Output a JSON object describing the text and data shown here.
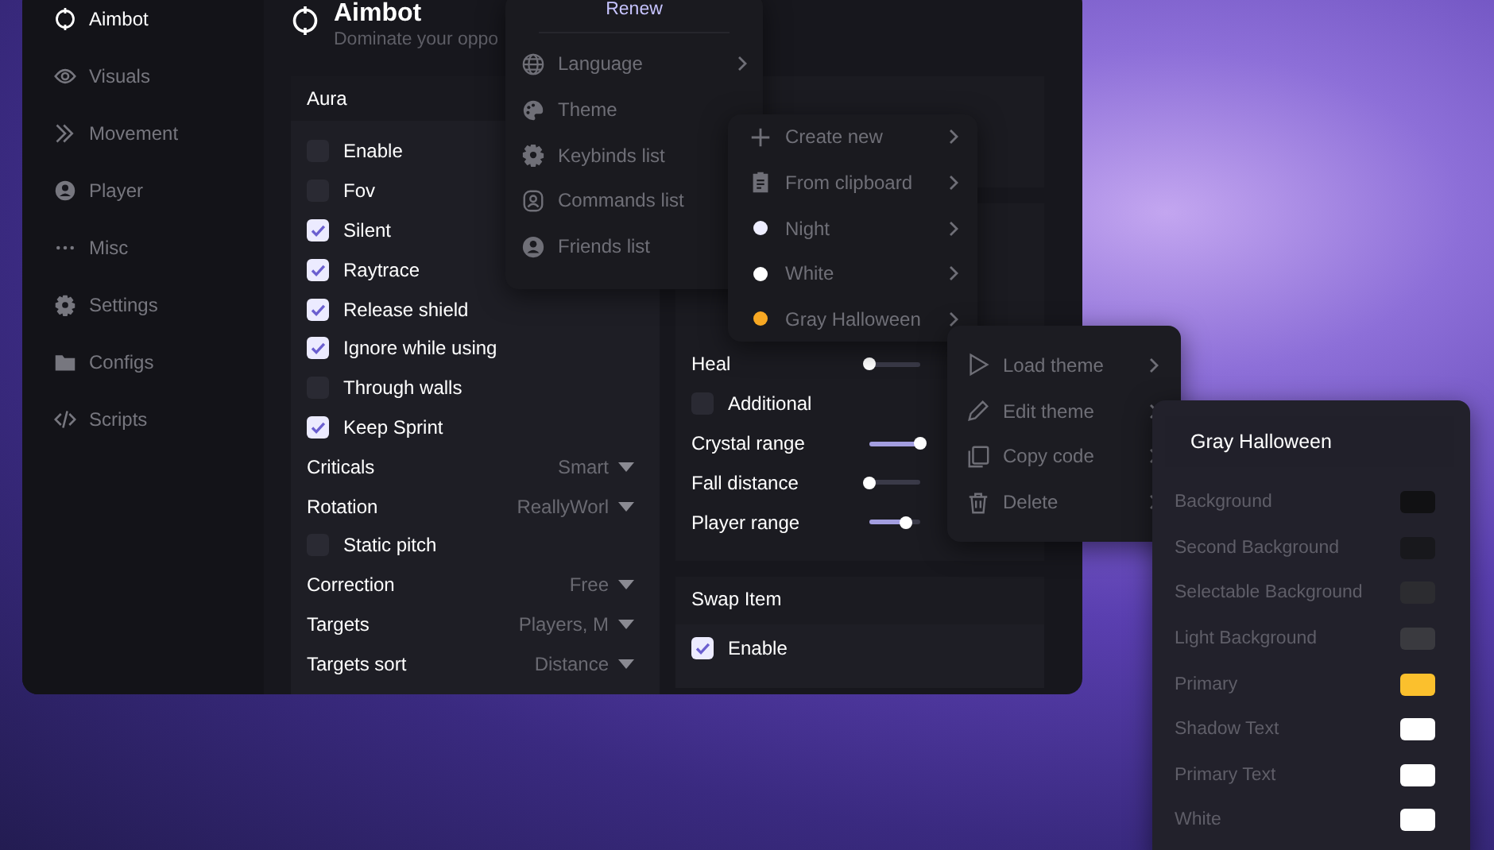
{
  "sidebar": {
    "items": [
      {
        "label": "Aimbot",
        "selected": true
      },
      {
        "label": "Visuals",
        "selected": false
      },
      {
        "label": "Movement",
        "selected": false
      },
      {
        "label": "Player",
        "selected": false
      },
      {
        "label": "Misc",
        "selected": false
      },
      {
        "label": "Settings",
        "selected": false
      },
      {
        "label": "Configs",
        "selected": false
      },
      {
        "label": "Scripts",
        "selected": false
      }
    ]
  },
  "header": {
    "title": "Aimbot",
    "subtitle": "Dominate your oppo"
  },
  "aura": {
    "title": "Aura",
    "rows": [
      {
        "kind": "checkbox",
        "label": "Enable",
        "checked": false
      },
      {
        "kind": "checkbox",
        "label": "Fov",
        "checked": false
      },
      {
        "kind": "checkbox",
        "label": "Silent",
        "checked": true
      },
      {
        "kind": "checkbox",
        "label": "Raytrace",
        "checked": true
      },
      {
        "kind": "checkbox",
        "label": "Release shield",
        "checked": true
      },
      {
        "kind": "checkbox",
        "label": "Ignore while using",
        "checked": true
      },
      {
        "kind": "checkbox",
        "label": "Through walls",
        "checked": false
      },
      {
        "kind": "checkbox",
        "label": "Keep Sprint",
        "checked": true
      },
      {
        "kind": "select",
        "label": "Criticals",
        "value": "Smart"
      },
      {
        "kind": "select",
        "label": "Rotation",
        "value": "ReallyWorl"
      },
      {
        "kind": "checkbox",
        "label": "Static pitch",
        "checked": false
      },
      {
        "kind": "select",
        "label": "Correction",
        "value": "Free"
      },
      {
        "kind": "select",
        "label": "Targets",
        "value": "Players, M"
      },
      {
        "kind": "select",
        "label": "Targets sort",
        "value": "Distance"
      }
    ]
  },
  "movement_panel": {
    "rows": [
      {
        "kind": "slider",
        "label": "Heal",
        "level": 0
      },
      {
        "kind": "checkbox",
        "label": "Additional",
        "checked": false
      },
      {
        "kind": "slider",
        "label": "Crystal range",
        "level": 1
      },
      {
        "kind": "slider",
        "label": "Fall distance",
        "level": 0
      },
      {
        "kind": "slider",
        "label": "Player range",
        "level": 0.72
      }
    ]
  },
  "swap_item": {
    "title": "Swap Item",
    "rows": [
      {
        "label": "Enable",
        "checked": true
      }
    ]
  },
  "menu": {
    "header": "Renew",
    "items": [
      {
        "label": "Language",
        "submenu": true
      },
      {
        "label": "Theme"
      },
      {
        "label": "Keybinds list"
      },
      {
        "label": "Commands list"
      },
      {
        "label": "Friends list"
      }
    ]
  },
  "theme_menu": {
    "items": [
      {
        "kind": "action",
        "label": "Create new"
      },
      {
        "kind": "action",
        "label": "From clipboard"
      },
      {
        "kind": "theme",
        "label": "Night",
        "color": "#eeeeff"
      },
      {
        "kind": "theme",
        "label": "White",
        "color": "#ffffff"
      },
      {
        "kind": "theme",
        "label": "Gray Halloween",
        "color": "#f7a823"
      }
    ]
  },
  "theme_actions": {
    "items": [
      "Load theme",
      "Edit theme",
      "Copy code",
      "Delete"
    ]
  },
  "theme_editor": {
    "title": "Gray Halloween",
    "colors": [
      {
        "label": "Background",
        "color": "#111113"
      },
      {
        "label": "Second Background",
        "color": "#18181c"
      },
      {
        "label": "Selectable Background",
        "color": "#2c2c30"
      },
      {
        "label": "Light Background",
        "color": "#3a3a3f"
      },
      {
        "label": "Primary",
        "color": "#fbc02d"
      },
      {
        "label": "Shadow Text",
        "color": "#ffffff"
      },
      {
        "label": "Primary Text",
        "color": "#ffffff"
      },
      {
        "label": "White",
        "color": "#ffffff"
      }
    ]
  }
}
